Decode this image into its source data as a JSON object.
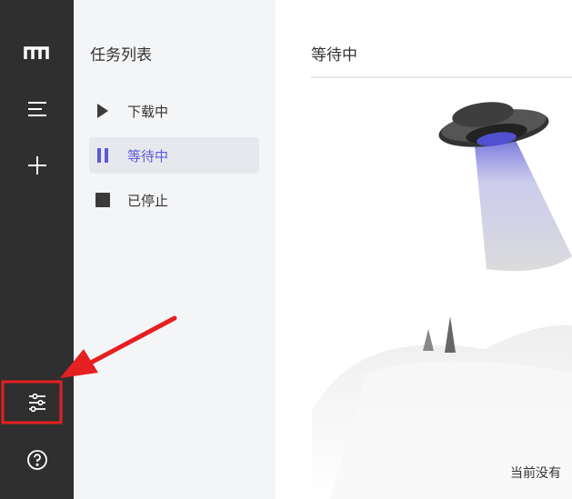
{
  "sidebar": {
    "icons": [
      {
        "name": "app-logo-icon"
      },
      {
        "name": "menu-icon"
      },
      {
        "name": "add-task-icon"
      },
      {
        "name": "settings-sliders-icon"
      },
      {
        "name": "help-icon"
      }
    ]
  },
  "task_panel": {
    "title": "任务列表",
    "items": [
      {
        "label": "下载中",
        "icon": "play-icon",
        "active": false
      },
      {
        "label": "等待中",
        "icon": "pause-icon",
        "active": true
      },
      {
        "label": "已停止",
        "icon": "stop-icon",
        "active": false
      }
    ]
  },
  "main": {
    "title": "等待中",
    "empty_text": "当前没有"
  },
  "colors": {
    "sidebar_bg": "#2f2f2f",
    "panel_bg": "#f4f5f7",
    "accent": "#5b5bd6",
    "annotation_red": "#e52020"
  }
}
